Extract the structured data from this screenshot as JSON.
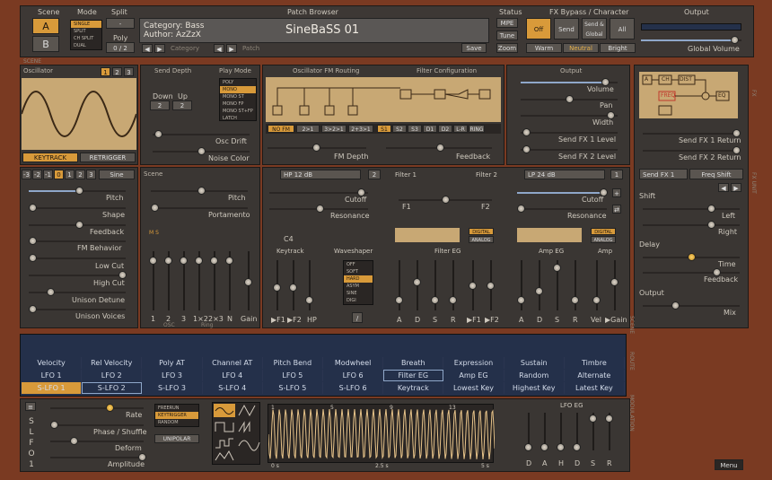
{
  "header": {
    "scene_label": "Scene",
    "scene_a": "A",
    "scene_b": "B",
    "mode_label": "Mode",
    "modes": [
      "SINGLE",
      "SPLIT",
      "CH SPLIT",
      "DUAL"
    ],
    "split_label": "Split",
    "split_value": "-",
    "poly_label": "Poly",
    "poly_value": "0 / 2",
    "patch_browser_label": "Patch Browser",
    "category_line": "Category: Bass",
    "author_line": "Author: AzZzX",
    "patch_name": "SineBaSS 01",
    "category_nav": "Category",
    "patch_nav": "Patch",
    "status_label": "Status",
    "status_buttons": [
      "MPE",
      "Tune",
      "Zoom"
    ],
    "save": "Save",
    "fx_label": "FX Bypass / Character",
    "fx_off": "Off",
    "fx_send": "Send",
    "fx_send_global": "Send & Global",
    "fx_all": "All",
    "char_warm": "Warm",
    "char_neutral": "Neutral",
    "char_bright": "Bright",
    "output_label": "Output",
    "global_volume": "Global Volume",
    "scene_tag": "SCENE"
  },
  "osc": {
    "title": "Oscillator",
    "tabs": [
      "1",
      "2",
      "3"
    ],
    "keytrack": "KEYTRACK",
    "retrigger": "RETRIGGER",
    "send_depth": "Send Depth",
    "down": "Down",
    "up": "Up",
    "down_v": "2",
    "up_v": "2",
    "play_mode": "Play Mode",
    "play_modes": [
      "POLY",
      "MONO",
      "MONO ST",
      "MONO FP",
      "MONO ST+FP",
      "LATCH"
    ],
    "osc_drift": "Osc Drift",
    "noise_color": "Noise Color",
    "routing_title": "Oscillator FM Routing",
    "filter_config": "Filter Configuration",
    "fm_depth": "FM Depth",
    "feedback": "Feedback",
    "fm_modes": [
      "NO FM",
      "2>1",
      "3>2>1",
      "2+3>1"
    ],
    "filter_modes": [
      "S1",
      "S2",
      "S3",
      "D1",
      "D2",
      "L-R",
      "RING"
    ],
    "output_title": "Output",
    "out_params": [
      "Volume",
      "Pan",
      "Width",
      "Send FX 1 Level",
      "Send FX 2 Level"
    ],
    "pitch_row": [
      "-3",
      "-2",
      "-1",
      "0",
      "1",
      "2",
      "3"
    ],
    "osc_type": "Sine",
    "params": [
      "Pitch",
      "Shape",
      "Feedback",
      "FM Behavior",
      "Low Cut",
      "High Cut",
      "Unison Detune",
      "Unison Voices"
    ]
  },
  "mixer": {
    "scene": "Scene",
    "pitch": "Pitch",
    "portamento": "Portamento",
    "labels": [
      "1",
      "2",
      "3",
      "1×2",
      "2×3",
      "N",
      "Gain"
    ],
    "osc": "OSC",
    "ring": "Ring",
    "ms": "M S"
  },
  "filter": {
    "f1type": "HP 12 dB",
    "f1num": "2",
    "f2type": "LP 24 dB",
    "f2num": "1",
    "filter1": "Filter 1",
    "filter2": "Filter 2",
    "cutoff": "Cutoff",
    "resonance": "Resonance",
    "f1": "F1",
    "f2": "F2",
    "keytrack": "Keytrack",
    "key": "C4",
    "waveshaper": "Waveshaper",
    "ws_list": [
      "OFF",
      "SOFT",
      "HARD",
      "ASYM",
      "SINE",
      "DIGI"
    ],
    "filter_eg": "Filter EG",
    "digital": "DIGITAL",
    "analog": "ANALOG",
    "amp_eg": "Amp EG",
    "amp": "Amp",
    "kt_labels": [
      "▶F1",
      "▶F2",
      "HP"
    ],
    "feg_labels": [
      "A",
      "D",
      "S",
      "R",
      "▶F1",
      "▶F2"
    ],
    "aeg_labels": [
      "A",
      "D",
      "S",
      "R",
      "Vel",
      "▶Gain"
    ]
  },
  "fx": {
    "diagram_labels": [
      "A",
      "CH",
      "DIST",
      "FREQ",
      "EQ"
    ],
    "send1_return": "Send FX 1 Return",
    "send2_return": "Send FX 2 Return",
    "send_select": "Send FX 1",
    "fx_type": "Freq Shift",
    "shift": "Shift",
    "left": "Left",
    "right": "Right",
    "delay": "Delay",
    "time": "Time",
    "feedback": "Feedback",
    "output": "Output",
    "mix": "Mix",
    "fx_tag": "FX",
    "fx_unit": "FX UNIT"
  },
  "modulation": {
    "row_sources": [
      "Velocity",
      "Rel Velocity",
      "Poly AT",
      "Channel AT",
      "Pitch Bend",
      "Modwheel",
      "Breath",
      "Expression",
      "Sustain",
      "Timbre"
    ],
    "row_lfo": [
      "LFO 1",
      "LFO 2",
      "LFO 3",
      "LFO 4",
      "LFO 5",
      "LFO 6",
      "Filter EG",
      "Amp EG",
      "Random",
      "Alternate"
    ],
    "row_slfo": [
      "S-LFO 1",
      "S-LFO 2",
      "S-LFO 3",
      "S-LFO 4",
      "S-LFO 5",
      "S-LFO 6",
      "Keytrack",
      "Lowest Key",
      "Highest Key",
      "Latest Key"
    ],
    "tags": [
      "SCENE",
      "ROUTE",
      "MODULATION"
    ]
  },
  "lfo": {
    "name": "S L F O 1",
    "params": [
      "Rate",
      "Phase / Shuffle",
      "Deform",
      "Amplitude"
    ],
    "trig": [
      "FREERUN",
      "KEYTRIGGER",
      "RANDOM"
    ],
    "unipolar": "UNIPOLAR",
    "ruler": [
      "1",
      "5",
      "9",
      "13"
    ],
    "time": [
      "0 s",
      "2.5 s",
      "5 s"
    ],
    "eg_title": "LFO EG",
    "eg_labels": [
      "D",
      "A",
      "H",
      "D",
      "S",
      "R"
    ],
    "menu": "Menu"
  }
}
